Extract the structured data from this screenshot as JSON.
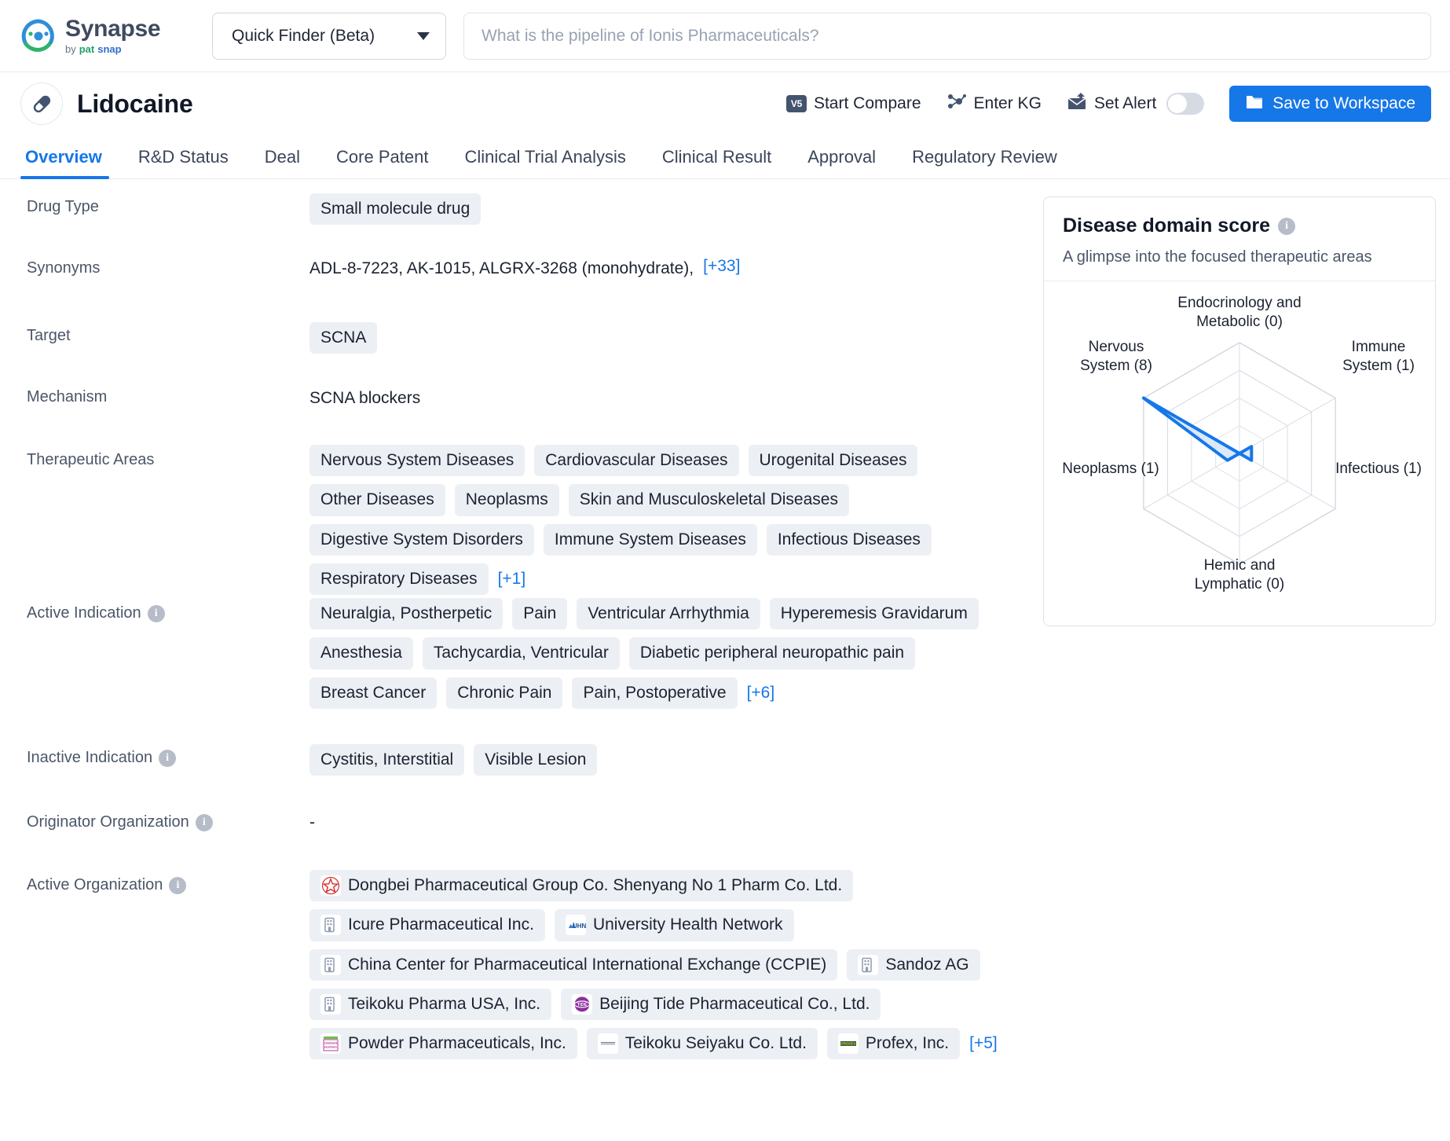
{
  "brand": {
    "name": "Synapse",
    "by": "by",
    "pat": "pat",
    "snap": "snap",
    "logo_icon": "synapse-logo-icon"
  },
  "search": {
    "mode_label": "Quick Finder (Beta)",
    "mode_caret_icon": "chevron-down-icon",
    "placeholder": "What is the pipeline of Ionis Pharmaceuticals?",
    "value": ""
  },
  "drug_header": {
    "icon": "pill-icon",
    "title": "Lidocaine",
    "actions": [
      {
        "label": "Start Compare",
        "icon": "v5-badge-icon",
        "badge_text": "V5"
      },
      {
        "label": "Enter KG",
        "icon": "knowledge-graph-icon"
      },
      {
        "label": "Set Alert",
        "icon": "alert-mail-icon",
        "toggle": "off"
      }
    ],
    "save_button": {
      "label": "Save to Workspace",
      "icon": "folder-icon",
      "color": "#1677e8"
    }
  },
  "tabs": [
    {
      "label": "Overview",
      "active": true
    },
    {
      "label": "R&D Status",
      "active": false
    },
    {
      "label": "Deal",
      "active": false
    },
    {
      "label": "Core Patent",
      "active": false
    },
    {
      "label": "Clinical Trial Analysis",
      "active": false
    },
    {
      "label": "Clinical Result",
      "active": false
    },
    {
      "label": "Approval",
      "active": false
    },
    {
      "label": "Regulatory Review",
      "active": false
    }
  ],
  "fields": {
    "drug_type": {
      "label": "Drug Type",
      "chips": [
        "Small molecule drug"
      ]
    },
    "synonyms": {
      "label": "Synonyms",
      "text": "ADL-8-7223,  AK-1015,  ALGRX-3268 (monohydrate),",
      "more": "[+33]"
    },
    "target": {
      "label": "Target",
      "chips": [
        "SCNA"
      ]
    },
    "mechanism": {
      "label": "Mechanism",
      "text": "SCNA blockers"
    },
    "therapeutic_areas": {
      "label": "Therapeutic Areas",
      "chips": [
        "Nervous System Diseases",
        "Cardiovascular Diseases",
        "Urogenital Diseases",
        "Other Diseases",
        "Neoplasms",
        "Skin and Musculoskeletal Diseases",
        "Digestive System Disorders",
        "Immune System Diseases",
        "Infectious Diseases",
        "Respiratory Diseases"
      ],
      "more": "[+1]"
    },
    "active_indication": {
      "label": "Active Indication",
      "info_icon": "info-icon",
      "chips": [
        "Neuralgia, Postherpetic",
        "Pain",
        "Ventricular Arrhythmia",
        "Hyperemesis Gravidarum",
        "Anesthesia",
        "Tachycardia, Ventricular",
        "Diabetic peripheral neuropathic pain",
        "Breast Cancer",
        "Chronic Pain",
        "Pain, Postoperative"
      ],
      "more": "[+6]"
    },
    "inactive_indication": {
      "label": "Inactive Indication",
      "info_icon": "info-icon",
      "chips": [
        "Cystitis, Interstitial",
        "Visible Lesion"
      ]
    },
    "originator_organization": {
      "label": "Originator Organization",
      "info_icon": "info-icon",
      "value": "-"
    },
    "active_organization": {
      "label": "Active Organization",
      "info_icon": "info-icon",
      "items": [
        {
          "name": "Dongbei Pharmaceutical Group Co. Shenyang No 1 Pharm Co. Ltd.",
          "logo": "red-star-logo",
          "logo_color": "#d32f2f"
        },
        {
          "name": "Icure Pharmaceutical Inc.",
          "logo": "generic-building-icon",
          "logo_color": "#8f9bb0"
        },
        {
          "name": "University Health Network",
          "logo": "uhn-logo",
          "logo_color": "#1e4b8f"
        },
        {
          "name": "China Center for Pharmaceutical International Exchange (CCPIE)",
          "logo": "generic-building-icon",
          "logo_color": "#8f9bb0"
        },
        {
          "name": "Sandoz AG",
          "logo": "generic-building-icon",
          "logo_color": "#8f9bb0"
        },
        {
          "name": "Teikoku Pharma USA, Inc.",
          "logo": "generic-building-icon",
          "logo_color": "#8f9bb0"
        },
        {
          "name": "Beijing Tide Pharmaceutical Co., Ltd.",
          "logo": "tide-logo",
          "logo_color": "#7b2d8e"
        },
        {
          "name": "Powder Pharmaceuticals, Inc.",
          "logo": "powder-pharma-logo",
          "logo_color": "#6fbf4a"
        },
        {
          "name": "Teikoku Seiyaku Co. Ltd.",
          "logo": "teikoku-seiyaku-logo",
          "logo_color": "#9aa3b2"
        },
        {
          "name": "Profex, Inc.",
          "logo": "profex-logo",
          "logo_color": "#4a6b3a"
        }
      ],
      "more": "[+5]"
    }
  },
  "disease_card": {
    "title": "Disease domain score",
    "info_icon": "info-icon",
    "subtitle": "A glimpse into the focused therapeutic areas"
  },
  "chart_data": {
    "type": "radar",
    "title": "Disease domain score",
    "subtitle": "A glimpse into the focused therapeutic areas",
    "categories": [
      "Endocrinology and Metabolic",
      "Immune System",
      "Infectious",
      "Hemic and Lymphatic",
      "Neoplasms",
      "Nervous System"
    ],
    "labels": [
      "Endocrinology and\nMetabolic (0)",
      "Immune\nSystem (1)",
      "Infectious (1)",
      "Hemic and\nLymphatic (0)",
      "Neoplasms (1)",
      "Nervous\nSystem (8)"
    ],
    "values": [
      0,
      1,
      1,
      0,
      1,
      8
    ],
    "max": 8,
    "rings": 4,
    "grid": true,
    "series_color": "#1677e8",
    "fill_color": "#cfe2f8",
    "grid_color": "#cfd4dc",
    "legend": "none"
  }
}
